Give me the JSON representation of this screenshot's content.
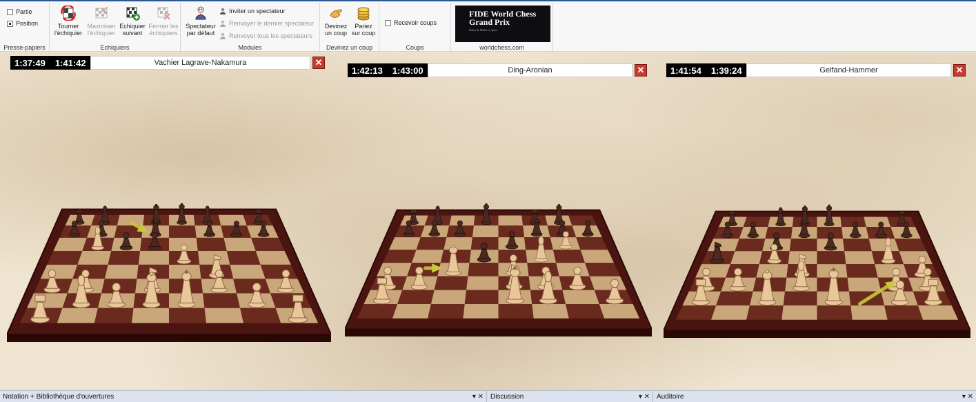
{
  "ribbon": {
    "clipboard": {
      "label": "Presse-papiers",
      "game": "Partie",
      "position": "Position"
    },
    "boards": {
      "label": "Echiquiers",
      "flip": [
        "Tourner",
        "l'échiquier"
      ],
      "maximize": [
        "Maximiser",
        "l'échiquier"
      ],
      "next": [
        "Echiquier",
        "suivant"
      ],
      "close": [
        "Fermer les",
        "échiquiers"
      ]
    },
    "modules": {
      "label": "Modules",
      "spectator": [
        "Spectateur",
        "par défaut"
      ],
      "invite": "Inviter un spectateur",
      "send_last": "Renvoyer le dernier spectateur",
      "send_all": "Renvoyer tous les spectateurs"
    },
    "guess": {
      "label": "Devinez un coup",
      "guess_move": [
        "Devinez",
        "un coup"
      ],
      "bet_move": [
        "Pariez",
        "sur coup"
      ]
    },
    "moves": {
      "label": "Coups",
      "receive": "Recevoir coups"
    },
    "worldchess": {
      "label": "worldchess.com",
      "banner_line1": "FIDE World Chess",
      "banner_line2": "Grand Prix",
      "banner_line3": "Palma de Mallorca, Spain"
    }
  },
  "boards": [
    {
      "clock_white": "1:37:49",
      "clock_black": "1:41:42",
      "name": "Vachier Lagrave-Nakamura"
    },
    {
      "clock_white": "1:42:13",
      "clock_black": "1:43:00",
      "name": "Ding-Aronian"
    },
    {
      "clock_white": "1:41:54",
      "clock_black": "1:39:24",
      "name": "Gelfand-Hammer"
    }
  ],
  "bottom": {
    "notation": "Notation + Bibliothèque d'ouvertures",
    "discussion": "Discussion",
    "audience": "Auditoire"
  },
  "colors": {
    "accent": "#2b5797",
    "board_frame": "#4a1410",
    "dark_square": "#6b2a1e",
    "light_square": "#caa77a",
    "white_piece": "#e9c79a",
    "black_piece": "#4a2a20",
    "arrow": "#c8c83a"
  }
}
